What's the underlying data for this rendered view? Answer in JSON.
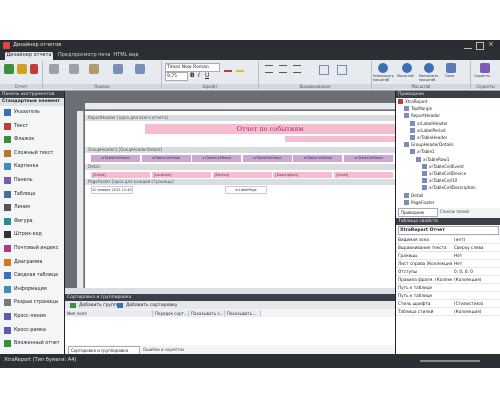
{
  "app": {
    "title": "Дизайнер отчетов",
    "tabs": [
      "Дизайнер отчета",
      "Предпросмотр печати",
      "HTML вид"
    ],
    "active_tab": 0,
    "quick_actions": [
      "Файл",
      "Вырезать",
      "Копировать",
      "Вставить",
      "Отменить",
      "Повторить"
    ],
    "font": "Times New Roman",
    "font_size": "9,75",
    "zoom_labels": [
      "Уменьшить масштаб",
      "Масштаб",
      "Увеличить масштаб",
      "Окно",
      "Скрипты"
    ],
    "ribbon_groups": [
      "Отчет",
      "Правка",
      "Шрифт",
      "Выравнивание",
      "Масштаб",
      "Окно",
      "Скрипты"
    ]
  },
  "toolbox": {
    "header": "Панель инструментов",
    "section": "Стандартные элемент",
    "items": [
      {
        "label": "Указатель",
        "icon": "pointer-icon",
        "color": "#3b6fb6"
      },
      {
        "label": "Текст",
        "icon": "text-icon",
        "color": "#c23b3b"
      },
      {
        "label": "Флажок",
        "icon": "checkbox-icon",
        "color": "#3a8f3a"
      },
      {
        "label": "Сложный текст",
        "icon": "rich-text-icon",
        "color": "#b07a2b"
      },
      {
        "label": "Картинка",
        "icon": "picture-icon",
        "color": "#3b8fb6"
      },
      {
        "label": "Панель",
        "icon": "panel-icon",
        "color": "#7b5bb6"
      },
      {
        "label": "Таблица",
        "icon": "table-icon",
        "color": "#4b6b9b"
      },
      {
        "label": "Линия",
        "icon": "line-icon",
        "color": "#555555"
      },
      {
        "label": "Фигура",
        "icon": "shape-icon",
        "color": "#2b8f8f"
      },
      {
        "label": "Штрих-код",
        "icon": "barcode-icon",
        "color": "#333333"
      },
      {
        "label": "Почтовый индекс",
        "icon": "zipcode-icon",
        "color": "#b03b7b"
      },
      {
        "label": "Диаграмма",
        "icon": "chart-icon",
        "color": "#d07a20"
      },
      {
        "label": "Сводная таблица",
        "icon": "pivot-icon",
        "color": "#3b6fb6"
      },
      {
        "label": "Информация",
        "icon": "info-icon",
        "color": "#3b8fb6"
      },
      {
        "label": "Разрыв страницы",
        "icon": "page-break-icon",
        "color": "#777777"
      },
      {
        "label": "Кросс-линия",
        "icon": "cross-line-icon",
        "color": "#5b5bb6"
      },
      {
        "label": "Кросс-рамка",
        "icon": "cross-band-icon",
        "color": "#5b5bb6"
      },
      {
        "label": "Вложенный отчет",
        "icon": "subreport-icon",
        "color": "#3a8f3a"
      }
    ]
  },
  "designer": {
    "bands": [
      "ReportHeader [одна для всего отчета]",
      "GroupHeader1 [GroupHeaderDetails]",
      "Detail",
      "PageFooter [одна для каждой страницы]"
    ],
    "report_title": "Отчет по событиям",
    "header_cells": [
      "xrTableCellHead",
      "xrTableCellHead",
      "xrTableCellHead",
      "xrTableCellHead",
      "xrTableCellHead",
      "xrTableCellHead"
    ],
    "detail_cells": [
      "[Event]",
      "[Location]",
      "[Device]",
      "[Description]",
      "[Level]"
    ],
    "footer_left": "20 января 2013 12:40",
    "footer_mid": "xrLabelPage"
  },
  "grouping": {
    "header": "Сортировка и группировка",
    "add_group": "Добавить группу",
    "add_sort": "Добавить сортировку",
    "columns": [
      "Имя поля",
      "Порядок сорт...",
      "Показывать з...",
      "Показывать..."
    ],
    "bottom_tabs": [
      "Сортировка и группировка",
      "Ошибки в скриптах"
    ]
  },
  "tree": {
    "header": "Приводник",
    "items": [
      "XtraReport",
      "TopMargin",
      "ReportHeader",
      "xrLabelHeader",
      "xrLabelPeriod",
      "xrTableHeader",
      "GroupHeaderDetails",
      "xrTable1",
      "xrTableRow1",
      "xrTableCellEvent",
      "xrTableCellDevice",
      "xrTableCell10",
      "xrTableCellDescription",
      "Detail",
      "PageFooter"
    ],
    "tabs": [
      "Приводник",
      "Список полей"
    ]
  },
  "props": {
    "header": "Таблица свойств",
    "object": "XtraReport  Отчет",
    "rows": [
      [
        "Видимая зона",
        "(нет)"
      ],
      [
        "Выравнивание текста",
        "Сверху слева"
      ],
      [
        "Границы",
        "Нет"
      ],
      [
        "Лист справа (Коллекция)",
        "Нет"
      ],
      [
        "Отступы",
        "0; 0; 0; 0"
      ],
      [
        "Правила фрагм. (Коллекция)",
        "(Коллекция)"
      ],
      [
        "Путь к таблице",
        ""
      ],
      [
        "Путь к таблице",
        ""
      ],
      [
        "Стиль шрифта",
        "(Стилистика)"
      ],
      [
        "Таблица стилей",
        "(Коллекция)"
      ]
    ]
  },
  "status": {
    "text": "XtraReport (Тип бумаги: A4)"
  },
  "colors": {
    "accent": "#3b6fb6",
    "pink": "#f6bcd0",
    "purple": "#7b5bb6"
  }
}
